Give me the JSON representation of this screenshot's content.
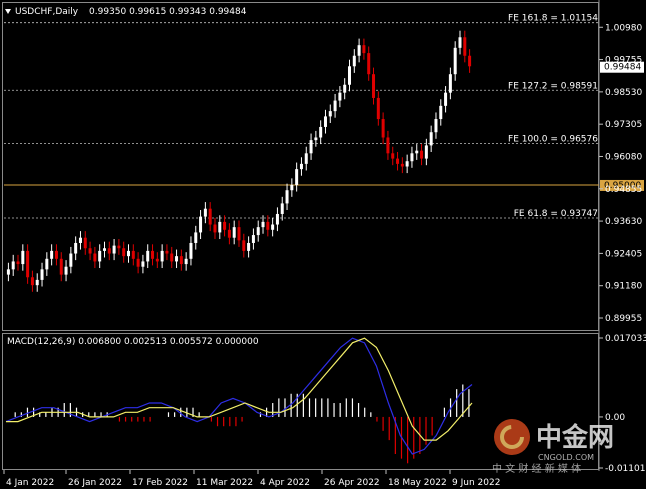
{
  "symbol": {
    "name": "USDCHF,Daily",
    "ohlc": "0.99350 0.99615 0.99343 0.99484"
  },
  "fib_levels": [
    {
      "label": "FE 161.8 = 1.01154",
      "price": 1.01154
    },
    {
      "label": "FE 127.2 = 0.98591",
      "price": 0.98591
    },
    {
      "label": "FE 100.0 = 0.96576",
      "price": 0.96576
    },
    {
      "label": "FE 61.8 = 0.93747",
      "price": 0.93747
    }
  ],
  "horizontal_line": {
    "label": "0.95000",
    "price": 0.95,
    "color": "#d9a441"
  },
  "current_price": {
    "label": "0.99484",
    "price": 0.99484
  },
  "price_axis": [
    "1.00980",
    "0.99755",
    "0.98530",
    "0.97305",
    "0.96080",
    "0.94855",
    "0.93630",
    "0.92405",
    "0.91180",
    "0.89955"
  ],
  "price_axis_values": [
    1.0098,
    0.99755,
    0.9853,
    0.97305,
    0.9608,
    0.94855,
    0.9363,
    0.92405,
    0.9118,
    0.89955
  ],
  "macd": {
    "title": "MACD(12,26,9) 0.006800 0.002513 0.005572 0.000000",
    "axis": [
      "0.017033",
      "0.00",
      "-0.011018"
    ],
    "axis_values": [
      0.017033,
      0.0,
      -0.011018
    ]
  },
  "date_axis": [
    "4 Jan 2022",
    "26 Jan 2022",
    "17 Feb 2022",
    "11 Mar 2022",
    "4 Apr 2022",
    "26 Apr 2022",
    "18 May 2022",
    "9 Jun 2022"
  ],
  "watermark": {
    "site_cn": "中金网",
    "site_en": "CNGOLD.COM",
    "tagline": "中 文 财 经 新 媒 体"
  },
  "colors": {
    "bull": "#ffffff",
    "bear": "#e00000",
    "macd_main": "#2e2ee6",
    "macd_signal": "#f2ee6a",
    "hline": "#d9a441"
  },
  "chart_data": {
    "type": "candlestick",
    "title": "USDCHF,Daily",
    "price_range": [
      0.895,
      1.019
    ],
    "closes": [
      0.918,
      0.921,
      0.92,
      0.925,
      0.915,
      0.912,
      0.914,
      0.918,
      0.922,
      0.925,
      0.922,
      0.916,
      0.919,
      0.924,
      0.928,
      0.93,
      0.926,
      0.924,
      0.921,
      0.925,
      0.926,
      0.924,
      0.927,
      0.926,
      0.923,
      0.925,
      0.922,
      0.919,
      0.921,
      0.925,
      0.922,
      0.921,
      0.925,
      0.924,
      0.921,
      0.923,
      0.92,
      0.922,
      0.928,
      0.932,
      0.938,
      0.941,
      0.935,
      0.932,
      0.936,
      0.933,
      0.93,
      0.934,
      0.929,
      0.925,
      0.928,
      0.931,
      0.934,
      0.936,
      0.933,
      0.935,
      0.939,
      0.943,
      0.948,
      0.95,
      0.956,
      0.958,
      0.962,
      0.967,
      0.968,
      0.972,
      0.976,
      0.978,
      0.982,
      0.985,
      0.988,
      0.995,
      0.999,
      1.003,
      1.0,
      0.992,
      0.983,
      0.975,
      0.968,
      0.962,
      0.96,
      0.958,
      0.957,
      0.959,
      0.962,
      0.963,
      0.96,
      0.965,
      0.97,
      0.975,
      0.98,
      0.985,
      0.992,
      1.002,
      1.006,
      0.999,
      0.995
    ],
    "macd_hist": [
      0.0,
      0.001,
      0.001,
      0.002,
      0.002,
      0.001,
      0.001,
      0.002,
      0.002,
      0.003,
      0.003,
      0.002,
      0.001,
      0.001,
      0.001,
      0.001,
      0.001,
      0.0,
      -0.001,
      -0.001,
      -0.001,
      -0.001,
      -0.001,
      -0.001,
      0.0,
      0.0,
      0.001,
      0.001,
      0.002,
      0.002,
      0.002,
      0.001,
      0.0,
      -0.001,
      -0.002,
      -0.002,
      -0.002,
      -0.002,
      -0.001,
      0.0,
      0.0,
      0.001,
      0.002,
      0.003,
      0.004,
      0.004,
      0.005,
      0.005,
      0.005,
      0.004,
      0.004,
      0.004,
      0.004,
      0.003,
      0.003,
      0.004,
      0.004,
      0.003,
      0.002,
      0.001,
      -0.001,
      -0.003,
      -0.005,
      -0.008,
      -0.009,
      -0.01,
      -0.009,
      -0.008,
      -0.006,
      -0.004,
      0.0,
      0.002,
      0.004,
      0.006,
      0.007,
      0.006
    ],
    "macd_main": [
      -0.001,
      0.0,
      0.001,
      0.002,
      0.002,
      0.001,
      0.0,
      -0.001,
      0.0,
      0.001,
      0.002,
      0.002,
      0.003,
      0.003,
      0.002,
      0.0,
      -0.001,
      0.0,
      0.003,
      0.004,
      0.003,
      0.001,
      0.0,
      0.001,
      0.003,
      0.006,
      0.009,
      0.012,
      0.015,
      0.017,
      0.016,
      0.011,
      0.003,
      -0.004,
      -0.008,
      -0.007,
      -0.004,
      0.001,
      0.005,
      0.007
    ],
    "macd_signal": [
      -0.001,
      -0.001,
      0.0,
      0.001,
      0.001,
      0.001,
      0.001,
      0.0,
      0.0,
      0.0,
      0.001,
      0.001,
      0.002,
      0.002,
      0.002,
      0.001,
      0.0,
      0.0,
      0.001,
      0.002,
      0.003,
      0.002,
      0.001,
      0.001,
      0.002,
      0.004,
      0.007,
      0.01,
      0.013,
      0.016,
      0.017,
      0.015,
      0.01,
      0.004,
      -0.002,
      -0.005,
      -0.005,
      -0.003,
      0.0,
      0.003
    ]
  }
}
